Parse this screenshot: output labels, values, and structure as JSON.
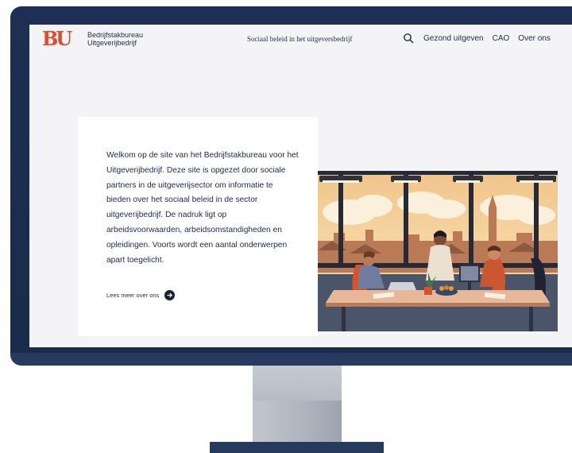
{
  "site": {
    "logo_text": "BU",
    "brand_line1": "Bedrijfstakbureau",
    "brand_line2": "Uitgeverijbedrijf"
  },
  "nav": {
    "center_link": "Sociaal beleid in het uitgeversbedrijf",
    "items": [
      {
        "label": "Gezond uitgeven"
      },
      {
        "label": "CAO"
      },
      {
        "label": "Over ons"
      }
    ]
  },
  "hero": {
    "intro": "Welkom op de site van het Bedrijfstakbureau voor het Uitgeverijbedrijf. Deze site is opgezet door sociale partners in de uitgeverijsector om informatie te bieden over het sociaal beleid in de sector uitgeverijbedrijf. De nadruk ligt op arbeidsvoorwaarden, arbeidsomstandigheden en opleidingen. Voorts wordt een aantal onderwerpen apart toegelicht.",
    "read_more": "Lees meer over ons"
  },
  "colors": {
    "accent": "#e24a2b",
    "text": "#1f2a44",
    "bezel": "#1d2f52",
    "screen_bg": "#f4f4f7"
  },
  "icons": {
    "search": "search-icon",
    "arrow": "arrow-right-icon"
  }
}
